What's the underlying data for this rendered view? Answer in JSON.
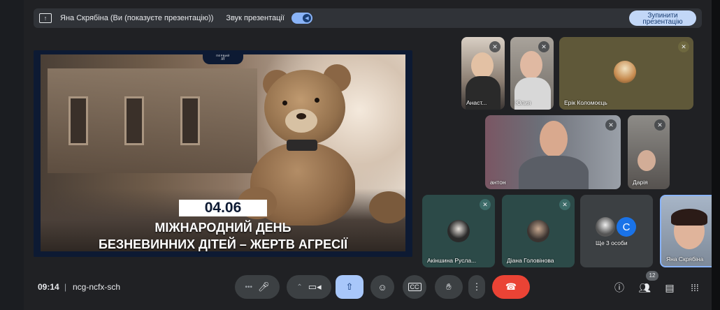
{
  "topbar": {
    "presenter_text": "Яна Скрябіна (Ви (показуєте презентацію))",
    "sound_label": "Звук презентації",
    "stop_button": "Зупинити презентацію"
  },
  "slide": {
    "logo_top": "ПЕРВИЙ",
    "logo_mark": "///",
    "date": "04.06",
    "title_line1": "МІЖНАРОДНИЙ ДЕНЬ",
    "title_line2": "БЕЗНЕВИННИХ ДІТЕЙ – ЖЕРТВ АГРЕСІЇ"
  },
  "participants": [
    {
      "name": "Анаст..."
    },
    {
      "name": "Юлия"
    },
    {
      "name": "Ерік Коломоєць"
    },
    {
      "name": "антон"
    },
    {
      "name": "Дарія"
    },
    {
      "name": "Акіншина Русла..."
    },
    {
      "name": "Діана Головінова"
    },
    {
      "name": "Ще 3 особи",
      "avatar_letter": "C"
    },
    {
      "name": "Яна Скрябіна"
    }
  ],
  "bottombar": {
    "time": "09:14",
    "separator": "|",
    "meeting_code": "ncg-ncfx-sch",
    "participants_count": "12"
  },
  "icons": {
    "mic": "microphone-icon",
    "camera": "camera-icon",
    "present": "present-screen-icon",
    "emoji": "emoji-icon",
    "captions": "captions-icon",
    "hand": "raise-hand-icon",
    "more": "more-vert-icon",
    "end": "call-end-icon",
    "info": "info-icon",
    "people": "people-icon",
    "chat": "chat-icon",
    "activities": "apps-icon"
  },
  "colors": {
    "background": "#202124",
    "accent": "#8ab4f8",
    "end_call": "#ea4335",
    "active_button": "#a8c7fa"
  }
}
